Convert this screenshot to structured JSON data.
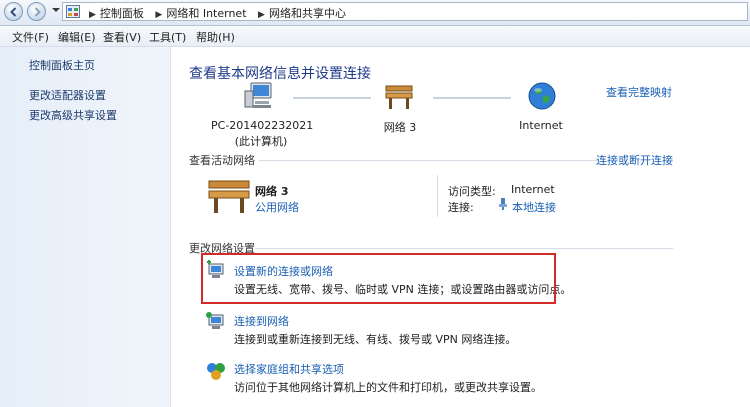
{
  "breadcrumbs": [
    "控制面板",
    "网络和 Internet",
    "网络和共享中心"
  ],
  "menu": [
    "文件(F)",
    "编辑(E)",
    "查看(V)",
    "工具(T)",
    "帮助(H)"
  ],
  "sidebar": {
    "items": [
      {
        "label": "控制面板主页"
      },
      {
        "label": "更改适配器设置"
      },
      {
        "label": "更改高级共享设置"
      }
    ]
  },
  "main": {
    "title": "查看基本网络信息并设置连接",
    "full_map_link": "查看完整映射",
    "nodes": [
      {
        "name": "PC-201402232021",
        "sub": "(此计算机)",
        "icon": "computer-icon"
      },
      {
        "name": "网络  3",
        "icon": "bench-icon"
      },
      {
        "name": "Internet",
        "icon": "globe-icon"
      }
    ],
    "active_section": "查看活动网络",
    "connect_disconnect_link": "连接或断开连接",
    "active_network": {
      "name": "网络  3",
      "type": "公用网络",
      "access_type_label": "访问类型:",
      "access_type_value": "Internet",
      "connection_label": "连接:",
      "connection_value": "本地连接"
    },
    "change_section": "更改网络设置",
    "tasks": [
      {
        "title": "设置新的连接或网络",
        "desc": "设置无线、宽带、拨号、临时或 VPN 连接；或设置路由器或访问点。",
        "icon": "new-connection-icon"
      },
      {
        "title": "连接到网络",
        "desc": "连接到或重新连接到无线、有线、拨号或 VPN 网络连接。",
        "icon": "connect-network-icon"
      },
      {
        "title": "选择家庭组和共享选项",
        "desc": "访问位于其他网络计算机上的文件和打印机，或更改共享设置。",
        "icon": "homegroup-icon"
      }
    ]
  },
  "colors": {
    "highlight": "#d22a2a",
    "link": "#1a5fb4",
    "title": "#1e3a8a"
  }
}
